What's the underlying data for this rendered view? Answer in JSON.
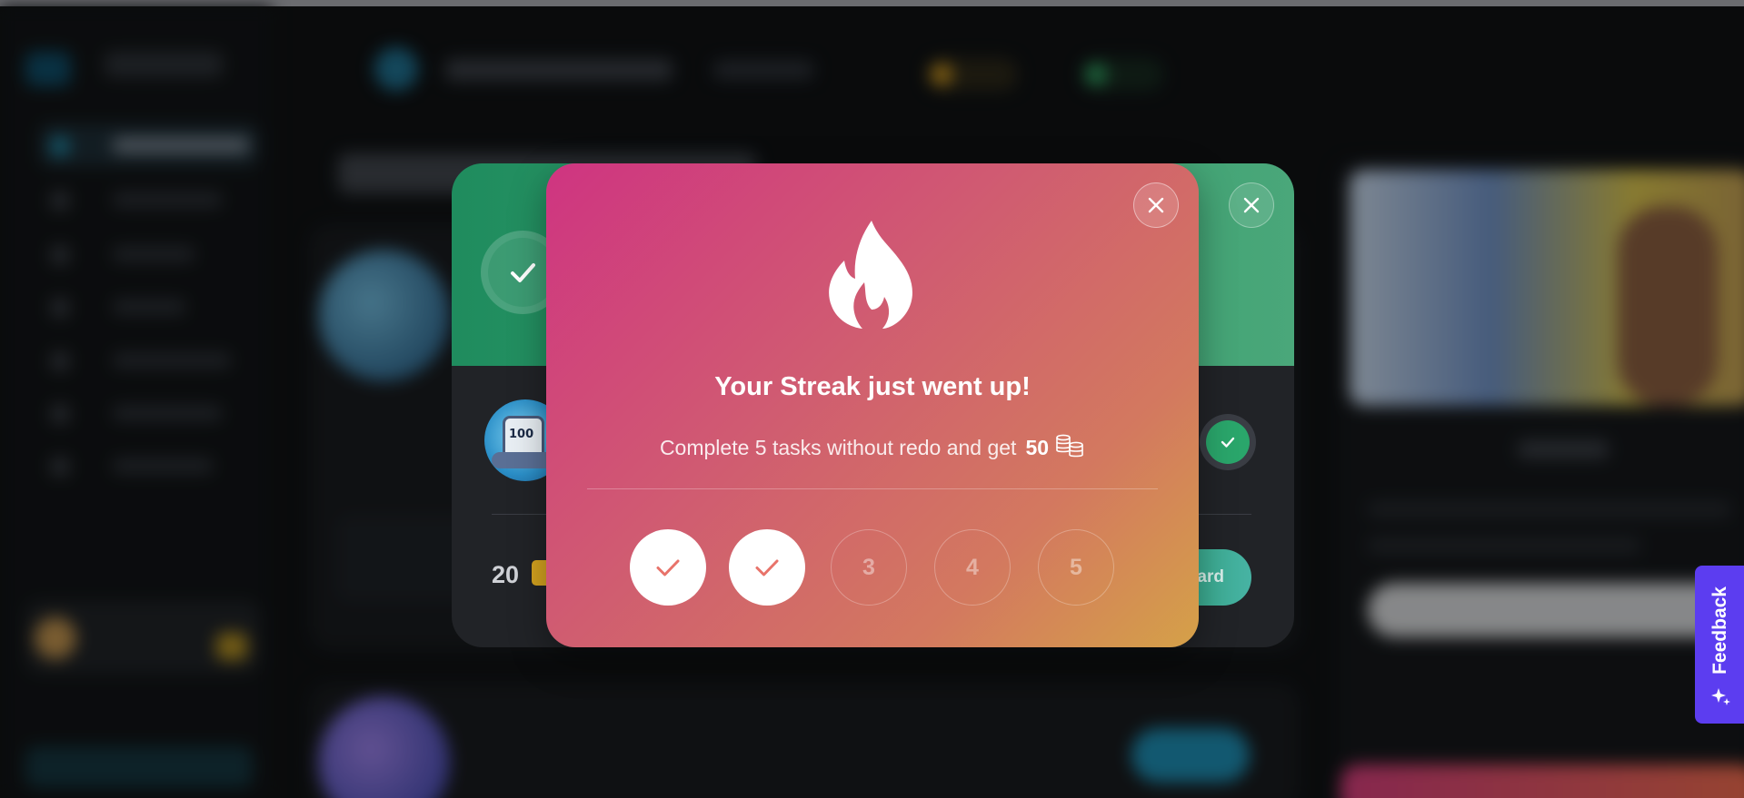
{
  "streak_modal": {
    "title": "Your Streak just went up!",
    "subtitle": "Complete 5 tasks without redo and get",
    "reward_amount": "50",
    "steps": [
      {
        "label": "",
        "done": true
      },
      {
        "label": "",
        "done": true
      },
      {
        "label": "3",
        "done": false
      },
      {
        "label": "4",
        "done": false
      },
      {
        "label": "5",
        "done": false
      }
    ],
    "close_icon": "close-icon",
    "fire_icon": "fire-icon",
    "coin_icon": "coin-stack-icon"
  },
  "reward_modal": {
    "amount": "20",
    "claim_label": "ard",
    "check_icon": "check-icon",
    "close_icon": "close-icon"
  },
  "feedback": {
    "label": "Feedback",
    "icon": "sparkle-icon"
  },
  "colors": {
    "streak_gradient_start": "#cf3481",
    "streak_gradient_end": "#d5a148",
    "reward_green": "#2aa66b",
    "feedback_purple": "#5c3df0",
    "check_coral": "#e8736a"
  }
}
